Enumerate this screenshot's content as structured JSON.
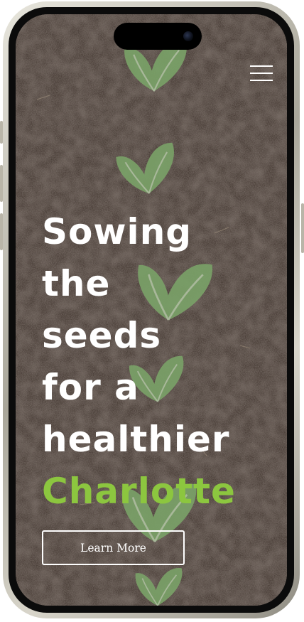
{
  "hero": {
    "headline_lines": [
      "Sowing",
      "the",
      "seeds",
      "for a",
      "healthier"
    ],
    "headline_accent": "Charlotte",
    "cta_label": "Learn More"
  },
  "header": {
    "menu_icon": "hamburger-menu-icon"
  },
  "background": {
    "image": "lettuce seedlings in soil"
  },
  "colors": {
    "accent": "#8cc63f",
    "text": "#ffffff",
    "soil": "#5a4d44"
  }
}
